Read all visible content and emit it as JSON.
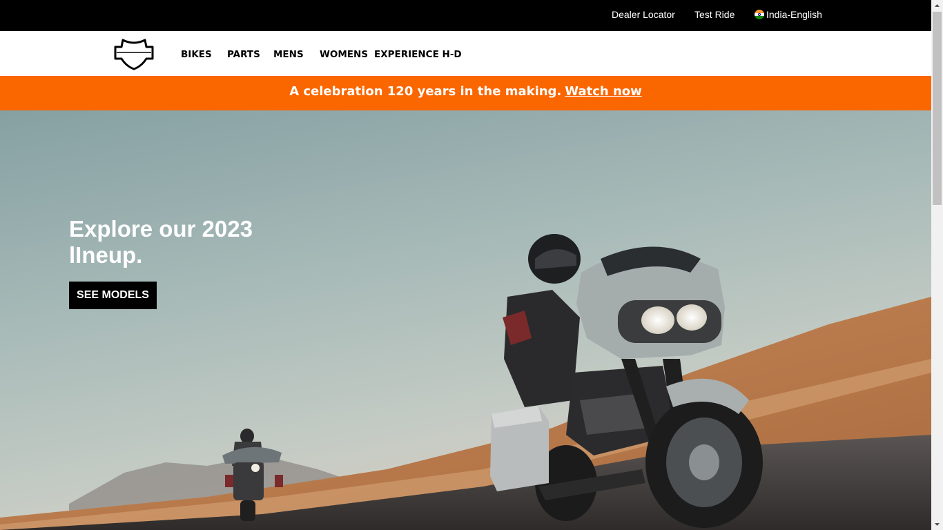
{
  "utility_nav": {
    "dealer_locator": "Dealer Locator",
    "test_ride": "Test Ride",
    "language": "India-English"
  },
  "main_nav": {
    "logo_icon": "harley-davidson-bar-and-shield-logo",
    "items": [
      {
        "label": "BIKES"
      },
      {
        "label": "PARTS"
      },
      {
        "label": "MENS"
      },
      {
        "label": "WOMENS"
      },
      {
        "label": "EXPERIENCE H-D"
      }
    ]
  },
  "promo_banner": {
    "text": "A celebration 120 years in the making.",
    "link_label": "Watch now",
    "color": "#fa6600"
  },
  "hero": {
    "headline": "Explore our 2023 lIneup.",
    "cta_label": "SEE MODELS",
    "image_description_icon": "motorcycle-riders-photo"
  },
  "colors": {
    "topbar": "#000000",
    "accent": "#fa6600",
    "button": "#000000"
  }
}
